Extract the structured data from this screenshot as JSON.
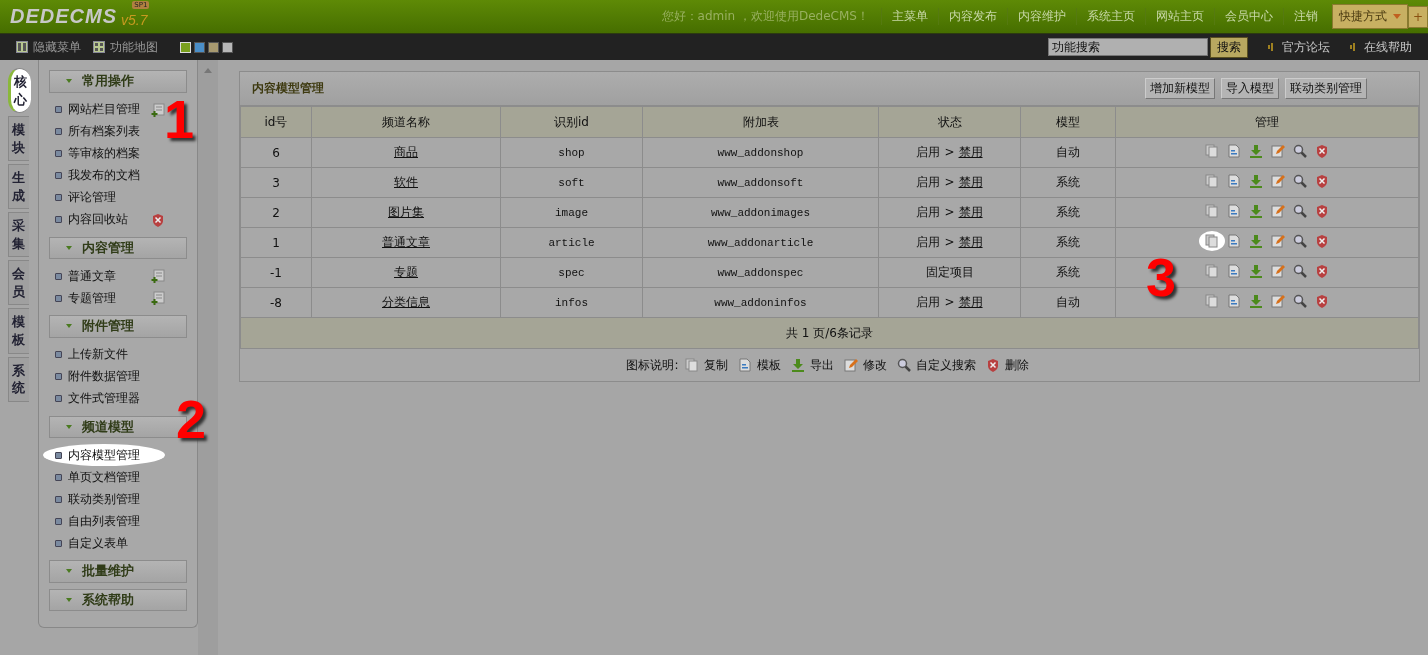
{
  "header": {
    "logo": "DEDECMS",
    "version": "v5.7",
    "badge": "SP1",
    "greeting": "您好：admin ，欢迎使用DedeCMS！",
    "nav": [
      "主菜单",
      "内容发布",
      "内容维护",
      "系统主页",
      "网站主页",
      "会员中心",
      "注销"
    ],
    "shortcut": {
      "label": "快捷方式",
      "plus": "+"
    }
  },
  "toolbar": {
    "left": [
      {
        "kind": "hide",
        "label": "隐藏菜单"
      },
      {
        "kind": "map",
        "label": "功能地图"
      }
    ],
    "themes": [
      {
        "color": "#7aa01e",
        "selected": true
      },
      {
        "color": "#4a8ec8",
        "selected": false
      },
      {
        "color": "#a89a70",
        "selected": false
      },
      {
        "color": "#b8b8b8",
        "selected": false
      }
    ],
    "search": {
      "value": "功能搜索",
      "button": "搜索"
    },
    "links": [
      "官方论坛",
      "在线帮助"
    ]
  },
  "side_tabs": [
    {
      "label": "核心",
      "selected": true,
      "highlighted": true
    },
    {
      "label": "模块",
      "selected": false,
      "highlighted": false
    },
    {
      "label": "生成",
      "selected": false,
      "highlighted": false
    },
    {
      "label": "采集",
      "selected": false,
      "highlighted": false
    },
    {
      "label": "会员",
      "selected": false,
      "highlighted": false
    },
    {
      "label": "模板",
      "selected": false,
      "highlighted": false
    },
    {
      "label": "系统",
      "selected": false,
      "highlighted": false
    }
  ],
  "sidebar": [
    {
      "title": "常用操作",
      "items": [
        {
          "label": "网站栏目管理",
          "kind": "add",
          "highlighted": false
        },
        {
          "label": "所有档案列表",
          "kind": "plain",
          "highlighted": false
        },
        {
          "label": "等审核的档案",
          "kind": "plain",
          "highlighted": false
        },
        {
          "label": "我发布的文档",
          "kind": "plain",
          "highlighted": false
        },
        {
          "label": "评论管理",
          "kind": "plain",
          "highlighted": false
        },
        {
          "label": "内容回收站",
          "kind": "delete",
          "highlighted": false
        }
      ]
    },
    {
      "title": "内容管理",
      "items": [
        {
          "label": "普通文章",
          "kind": "add",
          "highlighted": false
        },
        {
          "label": "专题管理",
          "kind": "add",
          "highlighted": false
        }
      ]
    },
    {
      "title": "附件管理",
      "items": [
        {
          "label": "上传新文件",
          "kind": "plain",
          "highlighted": false
        },
        {
          "label": "附件数据管理",
          "kind": "plain",
          "highlighted": false
        },
        {
          "label": "文件式管理器",
          "kind": "plain",
          "highlighted": false
        }
      ]
    },
    {
      "title": "频道模型",
      "items": [
        {
          "label": "内容模型管理",
          "kind": "plain",
          "highlighted": true
        },
        {
          "label": "单页文档管理",
          "kind": "plain",
          "highlighted": false
        },
        {
          "label": "联动类别管理",
          "kind": "plain",
          "highlighted": false
        },
        {
          "label": "自由列表管理",
          "kind": "plain",
          "highlighted": false
        },
        {
          "label": "自定义表单",
          "kind": "plain",
          "highlighted": false
        }
      ]
    },
    {
      "title": "批量维护"
    },
    {
      "title": "系统帮助"
    }
  ],
  "panel": {
    "title": "内容模型管理",
    "buttons": [
      "增加新模型",
      "导入模型",
      "联动类别管理"
    ],
    "columns": [
      "id号",
      "频道名称",
      "识别id",
      "附加表",
      "状态",
      "模型",
      "管理"
    ],
    "rows": [
      {
        "id": "6",
        "name": "商品",
        "nid": "shop",
        "table": "www_addonshop",
        "status": {
          "kind": "toggle",
          "current": "启用",
          "sep": ">",
          "link": "禁用"
        },
        "model": "自动",
        "highlighted": false
      },
      {
        "id": "3",
        "name": "软件",
        "nid": "soft",
        "table": "www_addonsoft",
        "status": {
          "kind": "toggle",
          "current": "启用",
          "sep": ">",
          "link": "禁用"
        },
        "model": "系统",
        "highlighted": false
      },
      {
        "id": "2",
        "name": "图片集",
        "nid": "image",
        "table": "www_addonimages",
        "status": {
          "kind": "toggle",
          "current": "启用",
          "sep": ">",
          "link": "禁用"
        },
        "model": "系统",
        "highlighted": false
      },
      {
        "id": "1",
        "name": "普通文章",
        "nid": "article",
        "table": "www_addonarticle",
        "status": {
          "kind": "toggle",
          "current": "启用",
          "sep": ">",
          "link": "禁用"
        },
        "model": "系统",
        "highlighted": true
      },
      {
        "id": "-1",
        "name": "专题",
        "nid": "spec",
        "table": "www_addonspec",
        "status": {
          "kind": "fixed",
          "text": "固定项目"
        },
        "model": "系统",
        "highlighted": false
      },
      {
        "id": "-8",
        "name": "分类信息",
        "nid": "infos",
        "table": "www_addoninfos",
        "status": {
          "kind": "toggle",
          "current": "启用",
          "sep": ">",
          "link": "禁用"
        },
        "model": "自动",
        "highlighted": false
      }
    ],
    "pager": "共 1 页/6条记录",
    "legend": {
      "label": "图标说明:",
      "items": [
        {
          "kind": "copy",
          "label": "复制"
        },
        {
          "kind": "template",
          "label": "模板"
        },
        {
          "kind": "export",
          "label": "导出"
        },
        {
          "kind": "edit",
          "label": "修改"
        },
        {
          "kind": "search",
          "label": "自定义搜索"
        },
        {
          "kind": "delete",
          "label": "删除"
        }
      ]
    }
  },
  "annotations": [
    "1",
    "2",
    "3"
  ]
}
